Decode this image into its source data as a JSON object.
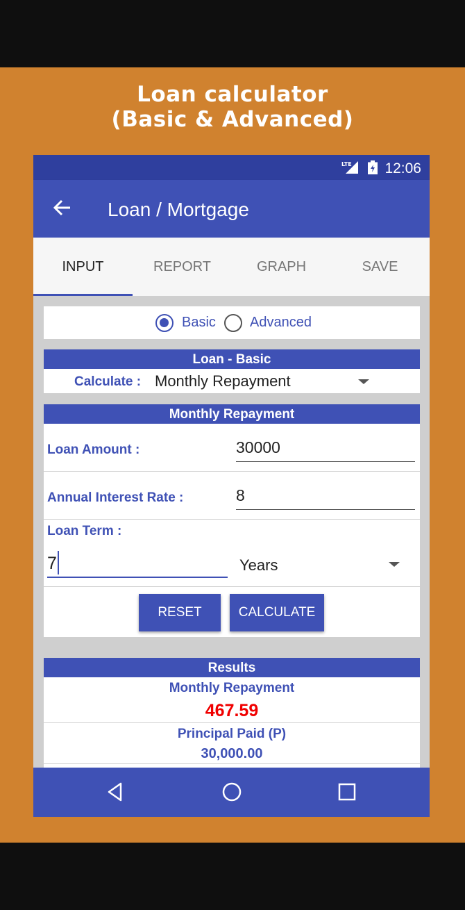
{
  "promo": {
    "line1": "Loan calculator",
    "line2": "(Basic & Advanced)"
  },
  "statusbar": {
    "time": "12:06",
    "network_icon": "lte-signal-icon",
    "battery_icon": "battery-icon"
  },
  "appbar": {
    "title": "Loan / Mortgage",
    "back_icon": "arrow-back-icon"
  },
  "tabs": [
    {
      "label": "INPUT",
      "active": true
    },
    {
      "label": "REPORT",
      "active": false
    },
    {
      "label": "GRAPH",
      "active": false
    },
    {
      "label": "SAVE",
      "active": false
    }
  ],
  "mode": {
    "basic_label": "Basic",
    "advanced_label": "Advanced",
    "selected": "Basic"
  },
  "loan_basic": {
    "header": "Loan - Basic",
    "calculate_label": "Calculate :",
    "calculate_value": "Monthly Repayment"
  },
  "monthly": {
    "header": "Monthly Repayment",
    "loan_amount_label": "Loan Amount :",
    "loan_amount_value": "30000",
    "interest_label": "Annual Interest Rate :",
    "interest_value": "8",
    "term_label": "Loan Term :",
    "term_value": "7",
    "term_unit": "Years"
  },
  "buttons": {
    "reset": "RESET",
    "calculate": "CALCULATE"
  },
  "results": {
    "header": "Results",
    "monthly_label": "Monthly Repayment",
    "monthly_value": "467.59",
    "principal_label": "Principal Paid (P)",
    "principal_value": "30,000.00"
  },
  "colors": {
    "primary": "#3f51b5",
    "background": "#d0822f",
    "result_red": "#f00000"
  }
}
